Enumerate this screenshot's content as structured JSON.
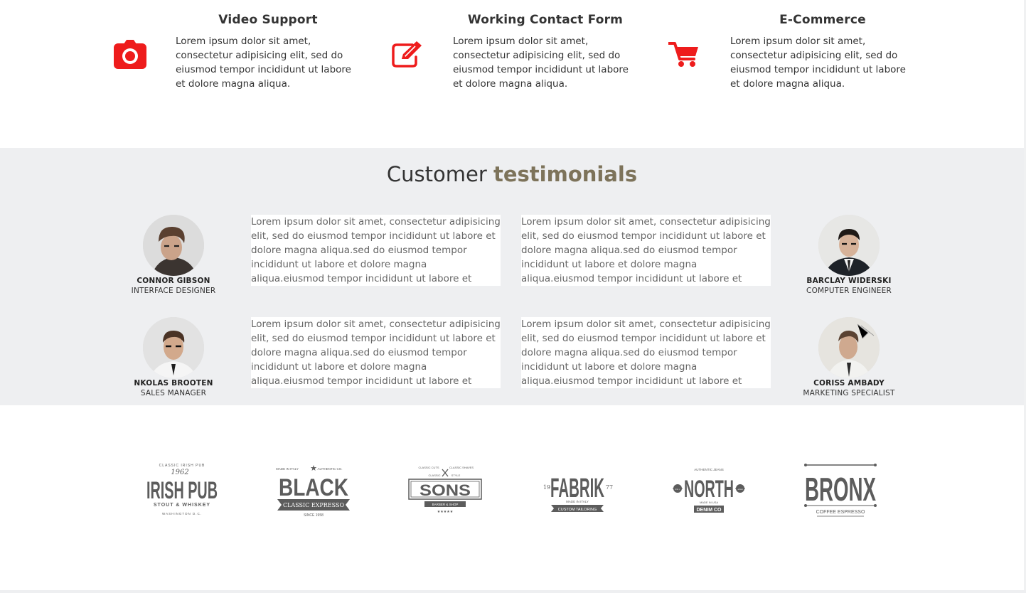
{
  "features": [
    {
      "title": "Video Support",
      "icon": "camera-icon",
      "text": "Lorem ipsum dolor sit amet, consectetur adipisicing elit, sed do eiusmod tempor incididunt ut labore et dolore magna aliqua."
    },
    {
      "title": "Working Contact Form",
      "icon": "edit-icon",
      "text": "Lorem ipsum dolor sit amet, consectetur adipisicing elit, sed do eiusmod tempor incididunt ut labore et dolore magna aliqua."
    },
    {
      "title": "E-Commerce",
      "icon": "shopping-cart-icon",
      "text": "Lorem ipsum dolor sit amet, consectetur adipisicing elit, sed do eiusmod tempor incididunt ut labore et dolore magna aliqua."
    }
  ],
  "testimonials": {
    "heading_main": "Customer",
    "heading_accent": "testimonials",
    "people": [
      {
        "name": "CONNOR GIBSON",
        "role": "INTERFACE DESIGNER"
      },
      {
        "name": "BARCLAY WIDERSKI",
        "role": "COMPUTER ENGINEER"
      },
      {
        "name": "NKOLAS BROOTEN",
        "role": "SALES MANAGER"
      },
      {
        "name": "CORISS AMBADY",
        "role": "MARKETING SPECIALIST"
      }
    ],
    "quotes": [
      "Lorem ipsum dolor sit amet, consectetur adipisicing elit, sed do eiusmod tempor incididunt ut labore et dolore magna aliqua.sed do eiusmod tempor incididunt ut labore et dolore magna aliqua.eiusmod tempor incididunt ut labore et dolore magna aliqua.",
      "Lorem ipsum dolor sit amet, consectetur adipisicing elit, sed do eiusmod tempor incididunt ut labore et dolore magna aliqua.sed do eiusmod tempor incididunt ut labore et dolore magna aliqua.eiusmod tempor incididunt ut labore et dolore magna aliqua.",
      "Lorem ipsum dolor sit amet, consectetur adipisicing elit, sed do eiusmod tempor incididunt ut labore et dolore magna aliqua.sed do eiusmod tempor incididunt ut labore et dolore magna aliqua.eiusmod tempor incididunt ut labore et dolore magna aliqua.",
      "Lorem ipsum dolor sit amet, consectetur adipisicing elit, sed do eiusmod tempor incididunt ut labore et dolore magna aliqua.sed do eiusmod tempor incididunt ut labore et dolore magna aliqua.eiusmod tempor incididunt ut labore et dolore magna aliqua."
    ]
  },
  "logos": {
    "irish_pub": {
      "top": "CLASSIC IRISH PUB",
      "year": "1962",
      "main": "IRISH PUB",
      "sub": "STOUT & WHISKEY",
      "place": "WASHINGTON D.C."
    },
    "black": {
      "left": "MADE IN ITALY",
      "right": "AUTHENTIC CO.",
      "main": "BLACK",
      "ribbon": "CLASSIC EXPRESSO",
      "since": "SINCE 1958"
    },
    "sons": {
      "left": "CLASSIC CUTS",
      "right": "CLASSIC SHAVES",
      "style_l": "CLASSIC",
      "style_r": "STYLE",
      "main": "SONS",
      "sub": "BARBER & SHOP",
      "stars": "★★★★★"
    },
    "fabrik": {
      "num_l": "19",
      "num_r": "77",
      "main": "FABRIK",
      "made": "MADE IN ITALY",
      "ribbon": "CUSTOM TAILORING"
    },
    "north": {
      "top": "AUTHENTIC JEANS",
      "main": "NORTH",
      "made": "MADE IN USA",
      "sub": "DENIM CO",
      "badge_l": "EST",
      "badge_r": "1960"
    },
    "bronx": {
      "main": "BRONX",
      "sub": "COFFEE ESPRESSO"
    }
  },
  "colors": {
    "accent_red": "#ee1c1c",
    "testimonial_accent": "#7d735a",
    "section_bg": "#eeeff1",
    "logo_gray": "#5c5c5c"
  }
}
